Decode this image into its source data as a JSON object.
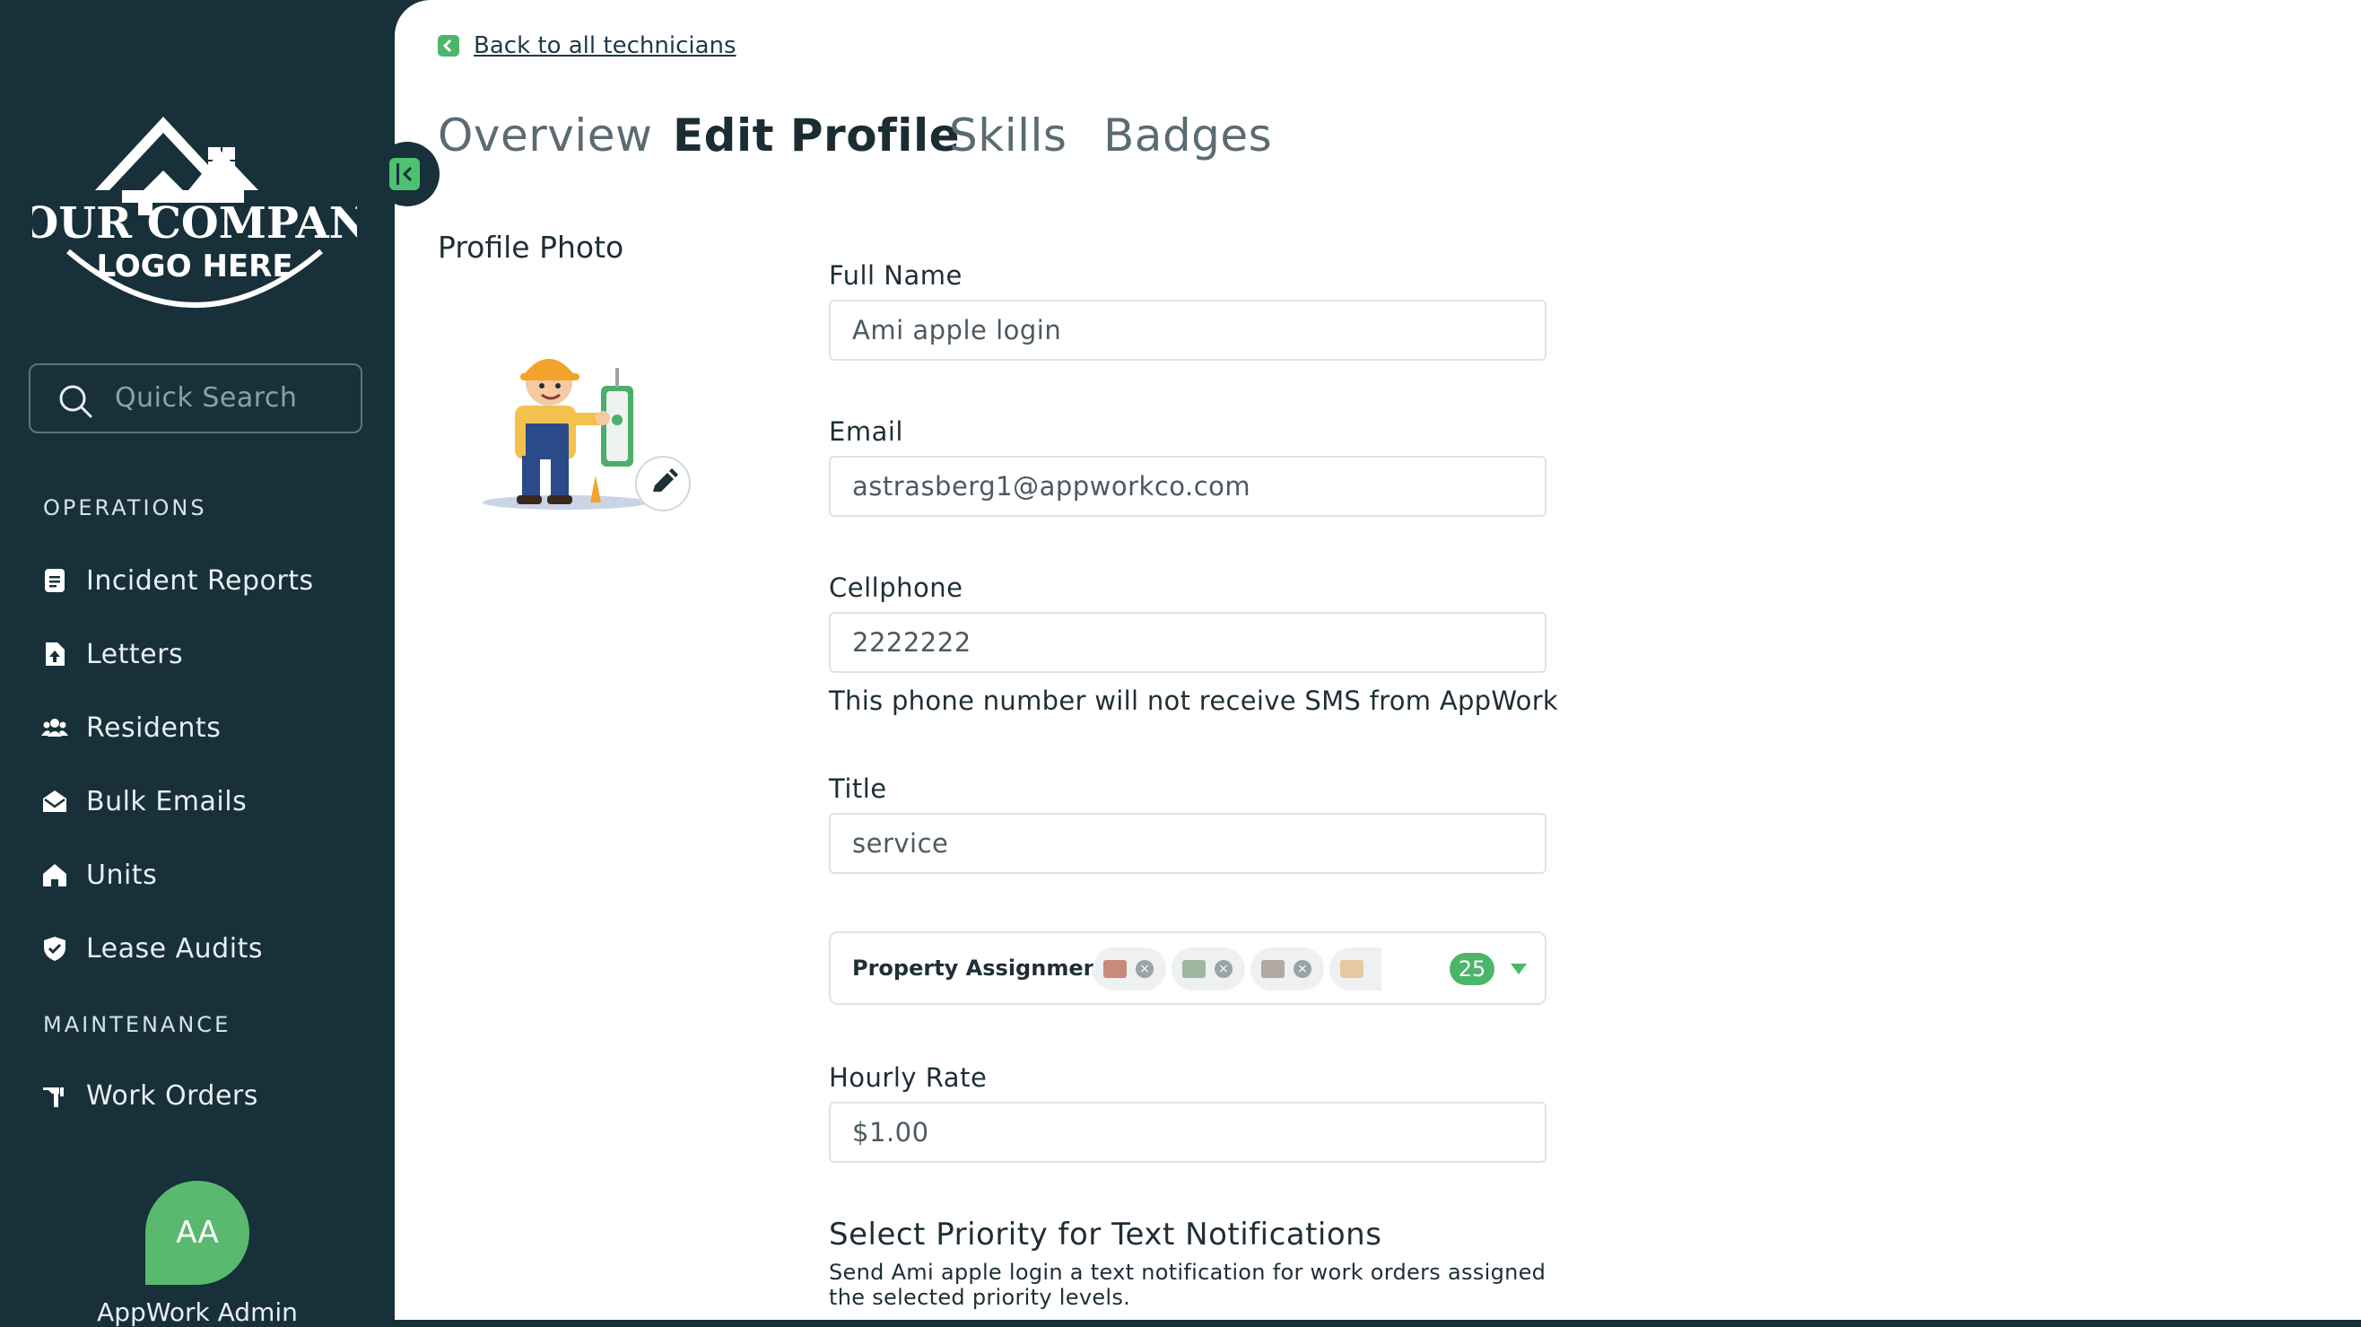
{
  "sidebar": {
    "logo": {
      "line1": "YOUR COMPANY",
      "line2": "LOGO HERE"
    },
    "search_placeholder": "Quick Search",
    "sections": [
      {
        "title": "OPERATIONS",
        "items": [
          {
            "label": "Incident Reports",
            "icon": "document-icon"
          },
          {
            "label": "Letters",
            "icon": "file-upload-icon"
          },
          {
            "label": "Residents",
            "icon": "people-icon"
          },
          {
            "label": "Bulk Emails",
            "icon": "envelope-open-icon"
          },
          {
            "label": "Units",
            "icon": "house-icon"
          },
          {
            "label": "Lease Audits",
            "icon": "shield-check-icon"
          }
        ]
      },
      {
        "title": "MAINTENANCE",
        "items": [
          {
            "label": "Work Orders",
            "icon": "hammer-icon"
          }
        ]
      }
    ],
    "user": {
      "initials": "AA",
      "name": "AppWork Admin"
    }
  },
  "main": {
    "back_link": "Back to all technicians",
    "tabs": [
      {
        "label": "Overview",
        "active": false
      },
      {
        "label": "Edit Profile",
        "active": true
      },
      {
        "label": "Skills",
        "active": false
      },
      {
        "label": "Badges",
        "active": false
      }
    ],
    "profile_photo_label": "Profile Photo",
    "form": {
      "full_name": {
        "label": "Full Name",
        "value": "Ami apple login"
      },
      "email": {
        "label": "Email",
        "value": "astrasberg1@appworkco.com"
      },
      "cellphone": {
        "label": "Cellphone",
        "value": "2222222",
        "help": "This phone number will not receive SMS from AppWork"
      },
      "title": {
        "label": "Title",
        "value": "service"
      },
      "property_assignment": {
        "label": "Property Assignment:",
        "count": "25"
      },
      "hourly_rate": {
        "label": "Hourly Rate",
        "value": "$1.00"
      }
    },
    "priority": {
      "title": "Select Priority for Text Notifications",
      "description": "Send Ami apple login a text notification for work orders assigned the selected priority levels."
    }
  },
  "colors": {
    "sidebar_bg": "#173039",
    "accent_green": "#4cb56b",
    "avatar_green": "#58b96f"
  }
}
